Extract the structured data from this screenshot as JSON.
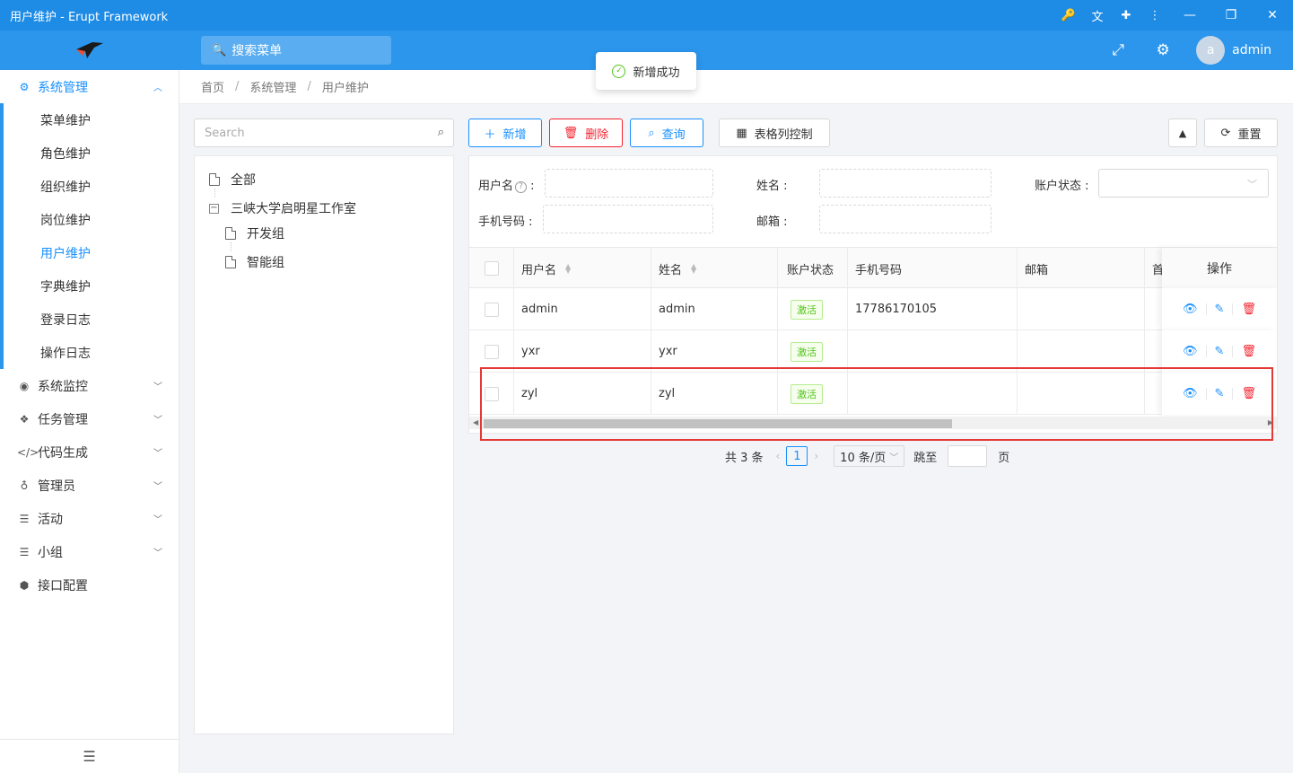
{
  "window": {
    "title": "用户维护 - Erupt Framework",
    "icons": [
      "key-icon",
      "translate-icon",
      "puzzle-icon",
      "more-icon"
    ],
    "controls": {
      "minimize": "—",
      "maximize": "❐",
      "close": "✕"
    }
  },
  "header": {
    "search_placeholder": "搜索菜单",
    "avatar_letter": "a",
    "username": "admin"
  },
  "toast": {
    "message": "新增成功"
  },
  "breadcrumb": [
    "首页",
    "系统管理",
    "用户维护"
  ],
  "sidebar": {
    "items": [
      {
        "label": "系统管理",
        "icon": "settings-icon",
        "expanded": true,
        "children": [
          "菜单维护",
          "角色维护",
          "组织维护",
          "岗位维护",
          "用户维护",
          "字典维护",
          "登录日志",
          "操作日志"
        ]
      },
      {
        "label": "系统监控",
        "icon": "monitor-icon"
      },
      {
        "label": "任务管理",
        "icon": "task-icon"
      },
      {
        "label": "代码生成",
        "icon": "code-icon"
      },
      {
        "label": "管理员",
        "icon": "medal-icon"
      },
      {
        "label": "活动",
        "icon": "list-icon"
      },
      {
        "label": "小组",
        "icon": "list-icon"
      },
      {
        "label": "接口配置",
        "icon": "cube-icon"
      }
    ],
    "active_child": "用户维护"
  },
  "tree": {
    "search_placeholder": "Search",
    "root": "全部",
    "org": "三峡大学启明星工作室",
    "groups": [
      "开发组",
      "智能组"
    ]
  },
  "toolbar": {
    "add": "新增",
    "delete": "删除",
    "query": "查询",
    "columns": "表格列控制",
    "reset": "重置"
  },
  "filters": {
    "username": "用户名",
    "name": "姓名",
    "status": "账户状态",
    "phone": "手机号码",
    "email": "邮箱",
    "colon": ":"
  },
  "table": {
    "columns": [
      "用户名",
      "姓名",
      "账户状态",
      "手机号码",
      "邮箱",
      "首",
      "操作"
    ],
    "rows": [
      {
        "username": "admin",
        "name": "admin",
        "status": "激活",
        "phone": "17786170105",
        "email": ""
      },
      {
        "username": "yxr",
        "name": "yxr",
        "status": "激活",
        "phone": "",
        "email": ""
      },
      {
        "username": "zyl",
        "name": "zyl",
        "status": "激活",
        "phone": "",
        "email": ""
      }
    ]
  },
  "pagination": {
    "total": "共 3 条",
    "current": "1",
    "page_size": "10 条/页",
    "jump_label": "跳至",
    "page_suffix": "页"
  }
}
